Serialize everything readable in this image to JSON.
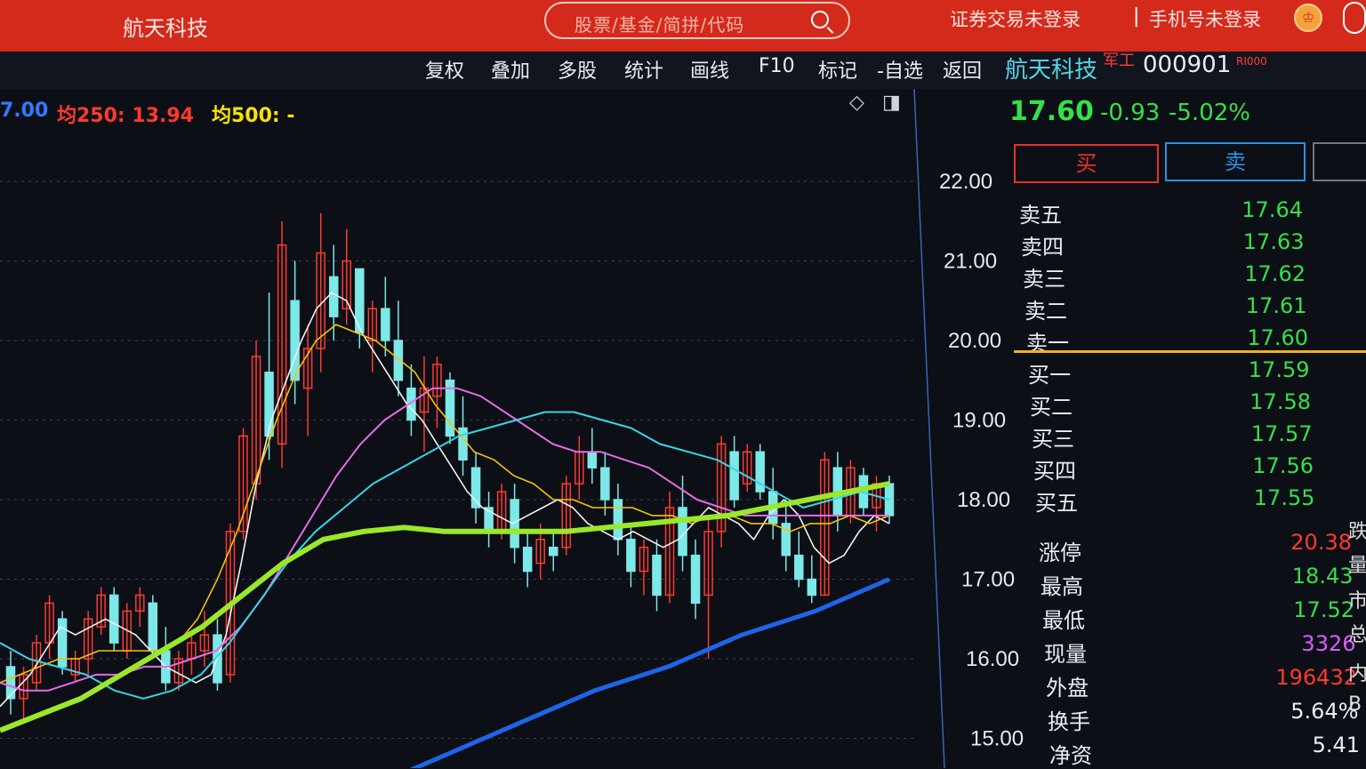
{
  "header": {
    "app_title": "航天科技",
    "search_placeholder": "股票/基金/简拼/代码",
    "trade_status": "证券交易未登录",
    "separator": "|",
    "phone_status": "手机号未登录",
    "user_icon_glyph": "♔"
  },
  "toolbar": {
    "items": [
      "复权",
      "叠加",
      "多股",
      "统计",
      "画线",
      "F10",
      "标记",
      "-自选",
      "返回"
    ]
  },
  "stock": {
    "name": "航天科技",
    "badge": "军工",
    "code": "000901",
    "tag": "RI000",
    "price": "17.60",
    "change": "-0.93",
    "change_pct": "-5.02%",
    "price_color": "#35e04a"
  },
  "ma_legend": [
    {
      "text": "7.00",
      "color": "#2f7bff"
    },
    {
      "text": "均250: 13.94",
      "color": "#ff3a2e"
    },
    {
      "text": "均500: -",
      "color": "#f5e400"
    }
  ],
  "chart_icons": {
    "diamond": "◇",
    "panel": "◨"
  },
  "trade_buttons": {
    "buy": "买",
    "sell": "卖"
  },
  "order_book": [
    {
      "label": "卖五",
      "value": "17.64"
    },
    {
      "label": "卖四",
      "value": "17.63"
    },
    {
      "label": "卖三",
      "value": "17.62"
    },
    {
      "label": "卖二",
      "value": "17.61"
    },
    {
      "label": "卖一",
      "value": "17.60"
    },
    {
      "label": "买一",
      "value": "17.59"
    },
    {
      "label": "买二",
      "value": "17.58"
    },
    {
      "label": "买三",
      "value": "17.57"
    },
    {
      "label": "买四",
      "value": "17.56"
    },
    {
      "label": "买五",
      "value": "17.55"
    }
  ],
  "stats": [
    {
      "label": "涨停",
      "value": "20.38",
      "color": "#ff3a2e"
    },
    {
      "label": "最高",
      "value": "18.43",
      "color": "#35e04a"
    },
    {
      "label": "最低",
      "value": "17.52",
      "color": "#35e04a"
    },
    {
      "label": "现量",
      "value": "3326",
      "color": "#d85cff"
    },
    {
      "label": "外盘",
      "value": "196432",
      "color": "#ff3a2e"
    },
    {
      "label": "换手",
      "value": "5.64%",
      "color": "#e9ecf4"
    },
    {
      "label": "净资",
      "value": "5.41",
      "color": "#e9ecf4"
    }
  ],
  "right_edge": [
    "跌",
    "量",
    "市",
    "总",
    "B",
    "内"
  ],
  "chart_data": {
    "type": "candlestick",
    "y_ticks": [
      "22.00",
      "21.00",
      "20.00",
      "19.00",
      "18.00",
      "17.00",
      "16.00",
      "15.00"
    ],
    "ylim": [
      14.6,
      22.3
    ],
    "up_color": "#ff3a2e",
    "down_color": "#7de8e8",
    "candles": [
      [
        15.9,
        16.1,
        15.3,
        15.5
      ],
      [
        15.5,
        15.9,
        15.2,
        15.8
      ],
      [
        15.7,
        16.3,
        15.6,
        16.2
      ],
      [
        16.2,
        16.8,
        16.0,
        16.7
      ],
      [
        16.5,
        16.6,
        15.8,
        15.9
      ],
      [
        15.8,
        16.1,
        15.7,
        16.0
      ],
      [
        16.0,
        16.6,
        15.8,
        16.5
      ],
      [
        16.4,
        16.9,
        16.3,
        16.8
      ],
      [
        16.8,
        16.9,
        16.1,
        16.2
      ],
      [
        16.1,
        16.7,
        16.0,
        16.6
      ],
      [
        16.6,
        16.9,
        16.4,
        16.8
      ],
      [
        16.7,
        16.8,
        16.0,
        16.1
      ],
      [
        16.1,
        16.4,
        15.6,
        15.7
      ],
      [
        15.7,
        16.1,
        15.6,
        16.0
      ],
      [
        16.0,
        16.3,
        15.8,
        16.2
      ],
      [
        16.1,
        16.6,
        15.9,
        16.3
      ],
      [
        16.3,
        16.5,
        15.6,
        15.7
      ],
      [
        15.8,
        17.7,
        15.7,
        17.6
      ],
      [
        17.6,
        18.9,
        17.5,
        18.8
      ],
      [
        18.2,
        20.0,
        18.0,
        19.8
      ],
      [
        19.6,
        20.6,
        18.5,
        18.8
      ],
      [
        18.7,
        21.5,
        18.4,
        21.2
      ],
      [
        20.5,
        21.0,
        19.2,
        19.5
      ],
      [
        19.4,
        20.2,
        18.8,
        19.9
      ],
      [
        19.9,
        21.6,
        19.6,
        21.1
      ],
      [
        20.8,
        21.2,
        20.0,
        20.3
      ],
      [
        20.4,
        21.4,
        20.2,
        21.0
      ],
      [
        20.9,
        20.9,
        19.9,
        20.1
      ],
      [
        20.0,
        20.5,
        19.6,
        20.4
      ],
      [
        20.4,
        20.8,
        19.8,
        20.0
      ],
      [
        20.0,
        20.5,
        19.3,
        19.5
      ],
      [
        19.4,
        19.7,
        18.8,
        19.0
      ],
      [
        19.1,
        19.8,
        18.6,
        19.4
      ],
      [
        19.3,
        19.8,
        18.9,
        19.7
      ],
      [
        19.5,
        19.6,
        18.7,
        18.8
      ],
      [
        18.9,
        19.3,
        18.3,
        18.5
      ],
      [
        18.4,
        18.6,
        17.7,
        17.9
      ],
      [
        17.9,
        18.1,
        17.4,
        17.6
      ],
      [
        17.6,
        18.2,
        17.5,
        18.1
      ],
      [
        18.0,
        18.2,
        17.2,
        17.4
      ],
      [
        17.4,
        17.6,
        16.9,
        17.1
      ],
      [
        17.2,
        17.7,
        17.0,
        17.5
      ],
      [
        17.4,
        17.6,
        17.1,
        17.3
      ],
      [
        17.4,
        18.3,
        17.3,
        18.2
      ],
      [
        18.2,
        18.8,
        18.0,
        18.6
      ],
      [
        18.6,
        18.9,
        18.2,
        18.4
      ],
      [
        18.4,
        18.6,
        17.8,
        18.0
      ],
      [
        18.0,
        18.2,
        17.3,
        17.5
      ],
      [
        17.5,
        17.7,
        16.9,
        17.1
      ],
      [
        17.1,
        17.5,
        16.8,
        17.4
      ],
      [
        17.3,
        17.5,
        16.6,
        16.8
      ],
      [
        16.8,
        18.1,
        16.7,
        17.9
      ],
      [
        17.9,
        18.3,
        17.1,
        17.3
      ],
      [
        17.3,
        17.5,
        16.5,
        16.7
      ],
      [
        16.8,
        17.8,
        16.0,
        17.6
      ],
      [
        17.6,
        18.8,
        17.4,
        18.7
      ],
      [
        18.6,
        18.8,
        17.9,
        18.0
      ],
      [
        18.2,
        18.7,
        18.1,
        18.6
      ],
      [
        18.6,
        18.7,
        18.0,
        18.1
      ],
      [
        18.1,
        18.4,
        17.5,
        17.7
      ],
      [
        17.7,
        18.0,
        17.1,
        17.3
      ],
      [
        17.3,
        17.6,
        16.9,
        17.0
      ],
      [
        17.0,
        17.3,
        16.7,
        16.8
      ],
      [
        16.8,
        18.6,
        16.8,
        18.5
      ],
      [
        18.4,
        18.6,
        17.6,
        17.8
      ],
      [
        17.8,
        18.5,
        17.7,
        18.4
      ],
      [
        18.3,
        18.4,
        17.8,
        17.9
      ],
      [
        17.9,
        18.3,
        17.6,
        18.2
      ],
      [
        18.2,
        18.3,
        17.7,
        17.8
      ]
    ],
    "ma_lines": [
      {
        "color": "#f2f2f2",
        "width": 1.6,
        "values": [
          15.4,
          15.6,
          15.8,
          16.1,
          16.4,
          16.3,
          16.4,
          16.5,
          16.4,
          16.3,
          16.1,
          15.9,
          15.8,
          15.7,
          15.8,
          16.3,
          17.2,
          18.2,
          19.0,
          19.5,
          20.0,
          20.4,
          20.6,
          20.5,
          20.1,
          19.8,
          19.5,
          19.2,
          19.0,
          18.7,
          18.4,
          18.1,
          17.9,
          17.8,
          17.7,
          17.8,
          17.9,
          18.0,
          17.9,
          17.7,
          17.6,
          17.5,
          17.6,
          17.5,
          17.4,
          17.5,
          17.7,
          17.9,
          17.8,
          17.7,
          17.5,
          17.8,
          18.0,
          17.8,
          17.4,
          17.2,
          17.3,
          17.6,
          17.8,
          17.7
        ]
      },
      {
        "color": "#f5c400",
        "width": 1.6,
        "values": [
          15.7,
          15.8,
          15.9,
          16.0,
          16.0,
          16.1,
          16.1,
          16.1,
          16.1,
          16.2,
          16.5,
          17.0,
          17.6,
          18.3,
          19.0,
          19.6,
          20.0,
          20.2,
          20.1,
          20.0,
          19.8,
          19.6,
          19.2,
          18.9,
          18.6,
          18.5,
          18.3,
          18.2,
          18.0,
          18.0,
          17.9,
          17.9,
          17.9,
          17.8,
          17.8,
          17.7,
          17.8,
          17.8,
          17.7,
          17.7,
          17.6,
          17.7,
          17.7,
          17.8,
          17.7,
          17.8
        ]
      },
      {
        "color": "#e86ae6",
        "width": 2,
        "values": [
          15.7,
          15.6,
          15.6,
          15.7,
          15.8,
          15.8,
          15.9,
          15.9,
          16.0,
          16.1,
          16.4,
          16.8,
          17.3,
          17.8,
          18.3,
          18.7,
          19.0,
          19.2,
          19.4,
          19.4,
          19.3,
          19.1,
          18.9,
          18.7,
          18.6,
          18.6,
          18.5,
          18.4,
          18.2,
          18.0,
          17.9,
          17.8,
          17.8,
          17.8,
          17.8,
          17.8,
          17.8,
          17.8
        ]
      },
      {
        "color": "#37d6e6",
        "width": 2,
        "values": [
          16.2,
          16.0,
          15.9,
          15.8,
          15.6,
          15.5,
          15.6,
          15.8,
          16.2,
          16.7,
          17.2,
          17.6,
          17.9,
          18.2,
          18.4,
          18.6,
          18.8,
          18.9,
          19.0,
          19.1,
          19.1,
          19.0,
          18.9,
          18.7,
          18.6,
          18.5,
          18.3,
          18.1,
          17.9,
          18.0,
          18.1,
          18.0
        ]
      },
      {
        "color": "#9ae82a",
        "width": 6,
        "values": [
          15.1,
          15.3,
          15.5,
          15.8,
          16.1,
          16.4,
          16.8,
          17.2,
          17.5,
          17.6,
          17.65,
          17.6,
          17.6,
          17.6,
          17.6,
          17.65,
          17.7,
          17.75,
          17.8,
          17.9,
          18.0,
          18.1,
          18.2
        ]
      },
      {
        "color": "#1e64e6",
        "width": 5,
        "values": [
          14.4,
          14.8,
          15.2,
          15.6,
          15.9,
          16.3,
          16.6,
          17.0
        ]
      }
    ]
  }
}
